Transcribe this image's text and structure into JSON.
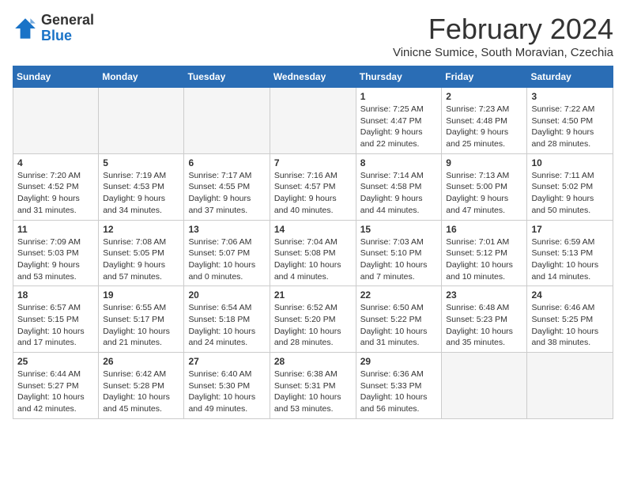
{
  "logo": {
    "text_general": "General",
    "text_blue": "Blue"
  },
  "header": {
    "month": "February 2024",
    "location": "Vinicne Sumice, South Moravian, Czechia"
  },
  "weekdays": [
    "Sunday",
    "Monday",
    "Tuesday",
    "Wednesday",
    "Thursday",
    "Friday",
    "Saturday"
  ],
  "weeks": [
    [
      {
        "day": "",
        "info": ""
      },
      {
        "day": "",
        "info": ""
      },
      {
        "day": "",
        "info": ""
      },
      {
        "day": "",
        "info": ""
      },
      {
        "day": "1",
        "info": "Sunrise: 7:25 AM\nSunset: 4:47 PM\nDaylight: 9 hours\nand 22 minutes."
      },
      {
        "day": "2",
        "info": "Sunrise: 7:23 AM\nSunset: 4:48 PM\nDaylight: 9 hours\nand 25 minutes."
      },
      {
        "day": "3",
        "info": "Sunrise: 7:22 AM\nSunset: 4:50 PM\nDaylight: 9 hours\nand 28 minutes."
      }
    ],
    [
      {
        "day": "4",
        "info": "Sunrise: 7:20 AM\nSunset: 4:52 PM\nDaylight: 9 hours\nand 31 minutes."
      },
      {
        "day": "5",
        "info": "Sunrise: 7:19 AM\nSunset: 4:53 PM\nDaylight: 9 hours\nand 34 minutes."
      },
      {
        "day": "6",
        "info": "Sunrise: 7:17 AM\nSunset: 4:55 PM\nDaylight: 9 hours\nand 37 minutes."
      },
      {
        "day": "7",
        "info": "Sunrise: 7:16 AM\nSunset: 4:57 PM\nDaylight: 9 hours\nand 40 minutes."
      },
      {
        "day": "8",
        "info": "Sunrise: 7:14 AM\nSunset: 4:58 PM\nDaylight: 9 hours\nand 44 minutes."
      },
      {
        "day": "9",
        "info": "Sunrise: 7:13 AM\nSunset: 5:00 PM\nDaylight: 9 hours\nand 47 minutes."
      },
      {
        "day": "10",
        "info": "Sunrise: 7:11 AM\nSunset: 5:02 PM\nDaylight: 9 hours\nand 50 minutes."
      }
    ],
    [
      {
        "day": "11",
        "info": "Sunrise: 7:09 AM\nSunset: 5:03 PM\nDaylight: 9 hours\nand 53 minutes."
      },
      {
        "day": "12",
        "info": "Sunrise: 7:08 AM\nSunset: 5:05 PM\nDaylight: 9 hours\nand 57 minutes."
      },
      {
        "day": "13",
        "info": "Sunrise: 7:06 AM\nSunset: 5:07 PM\nDaylight: 10 hours\nand 0 minutes."
      },
      {
        "day": "14",
        "info": "Sunrise: 7:04 AM\nSunset: 5:08 PM\nDaylight: 10 hours\nand 4 minutes."
      },
      {
        "day": "15",
        "info": "Sunrise: 7:03 AM\nSunset: 5:10 PM\nDaylight: 10 hours\nand 7 minutes."
      },
      {
        "day": "16",
        "info": "Sunrise: 7:01 AM\nSunset: 5:12 PM\nDaylight: 10 hours\nand 10 minutes."
      },
      {
        "day": "17",
        "info": "Sunrise: 6:59 AM\nSunset: 5:13 PM\nDaylight: 10 hours\nand 14 minutes."
      }
    ],
    [
      {
        "day": "18",
        "info": "Sunrise: 6:57 AM\nSunset: 5:15 PM\nDaylight: 10 hours\nand 17 minutes."
      },
      {
        "day": "19",
        "info": "Sunrise: 6:55 AM\nSunset: 5:17 PM\nDaylight: 10 hours\nand 21 minutes."
      },
      {
        "day": "20",
        "info": "Sunrise: 6:54 AM\nSunset: 5:18 PM\nDaylight: 10 hours\nand 24 minutes."
      },
      {
        "day": "21",
        "info": "Sunrise: 6:52 AM\nSunset: 5:20 PM\nDaylight: 10 hours\nand 28 minutes."
      },
      {
        "day": "22",
        "info": "Sunrise: 6:50 AM\nSunset: 5:22 PM\nDaylight: 10 hours\nand 31 minutes."
      },
      {
        "day": "23",
        "info": "Sunrise: 6:48 AM\nSunset: 5:23 PM\nDaylight: 10 hours\nand 35 minutes."
      },
      {
        "day": "24",
        "info": "Sunrise: 6:46 AM\nSunset: 5:25 PM\nDaylight: 10 hours\nand 38 minutes."
      }
    ],
    [
      {
        "day": "25",
        "info": "Sunrise: 6:44 AM\nSunset: 5:27 PM\nDaylight: 10 hours\nand 42 minutes."
      },
      {
        "day": "26",
        "info": "Sunrise: 6:42 AM\nSunset: 5:28 PM\nDaylight: 10 hours\nand 45 minutes."
      },
      {
        "day": "27",
        "info": "Sunrise: 6:40 AM\nSunset: 5:30 PM\nDaylight: 10 hours\nand 49 minutes."
      },
      {
        "day": "28",
        "info": "Sunrise: 6:38 AM\nSunset: 5:31 PM\nDaylight: 10 hours\nand 53 minutes."
      },
      {
        "day": "29",
        "info": "Sunrise: 6:36 AM\nSunset: 5:33 PM\nDaylight: 10 hours\nand 56 minutes."
      },
      {
        "day": "",
        "info": ""
      },
      {
        "day": "",
        "info": ""
      }
    ]
  ]
}
